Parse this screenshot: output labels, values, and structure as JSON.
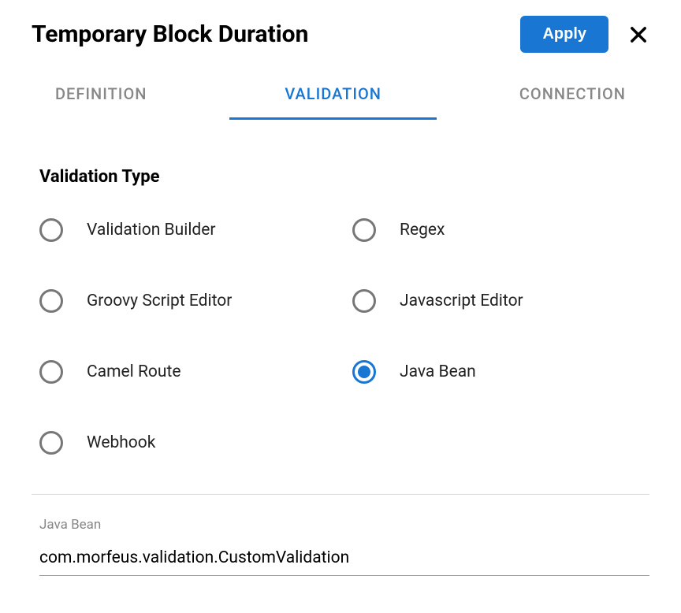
{
  "header": {
    "title": "Temporary Block Duration",
    "apply_label": "Apply"
  },
  "tabs": {
    "definition": "DEFINITION",
    "validation": "VALIDATION",
    "connection": "CONNECTION"
  },
  "section": {
    "title": "Validation Type"
  },
  "options": {
    "validation_builder": "Validation Builder",
    "regex": "Regex",
    "groovy_script_editor": "Groovy Script Editor",
    "javascript_editor": "Javascript Editor",
    "camel_route": "Camel Route",
    "java_bean": "Java Bean",
    "webhook": "Webhook"
  },
  "input": {
    "label": "Java Bean",
    "value": "com.morfeus.validation.CustomValidation"
  }
}
